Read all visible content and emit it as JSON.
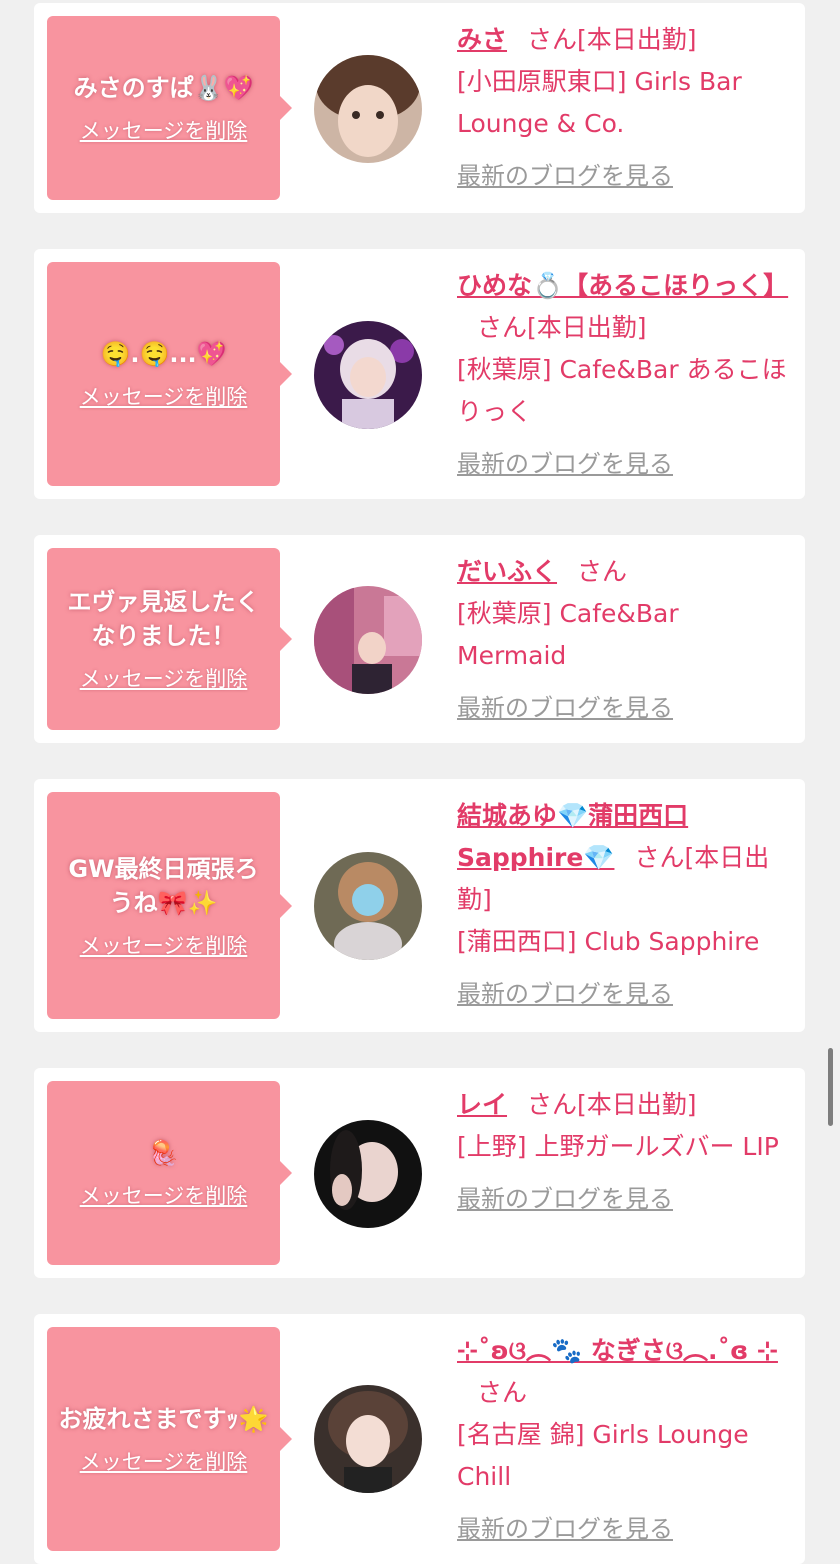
{
  "colors": {
    "accent": "#e23b68",
    "bubble": "#f8949f",
    "card": "#ffffff",
    "background": "#f0f0f0",
    "blog_link": "#9a9a9a"
  },
  "entries": [
    {
      "message": "みさのすぱ🐰💖",
      "delete_label": "メッセージを削除",
      "name": "みさ",
      "honorific": "さん",
      "status": "[本日出勤]",
      "shop": "[小田原駅東口] Girls Bar Lounge & Co.",
      "blog_link": "最新のブログを見る",
      "avatar_icon": "avatar-photo"
    },
    {
      "message": "🤤.🤤...💖",
      "delete_label": "メッセージを削除",
      "name": "ひめな💍【あるこほりっく】",
      "honorific": "さん",
      "status": "[本日出勤]",
      "shop": "[秋葉原] Cafe&Bar あるこほりっく",
      "blog_link": "最新のブログを見る",
      "avatar_icon": "avatar-photo"
    },
    {
      "message": "エヴァ見返したくなりました！",
      "delete_label": "メッセージを削除",
      "name": "だいふく",
      "honorific": "さん",
      "status": "",
      "shop": "[秋葉原] Cafe&Bar Mermaid",
      "blog_link": "最新のブログを見る",
      "avatar_icon": "avatar-photo"
    },
    {
      "message": "GW最終日頑張ろうね🎀✨",
      "delete_label": "メッセージを削除",
      "name": "結城あゆ💎蒲田西口Sapphire💎",
      "honorific": "さん",
      "status": "[本日出勤]",
      "shop": "[蒲田西口] Club Sapphire",
      "blog_link": "最新のブログを見る",
      "avatar_icon": "avatar-photo"
    },
    {
      "message": "🪼",
      "delete_label": "メッセージを削除",
      "name": "レイ",
      "honorific": "さん",
      "status": "[本日出勤]",
      "shop": "[上野] 上野ガールズバー LIP",
      "blog_link": "最新のブログを見る",
      "avatar_icon": "avatar-photo"
    },
    {
      "message": "お疲れさまですｯ🌟",
      "delete_label": "メッセージを削除",
      "name": "⊹˚ʚ︎ଓ︵🐾 なぎさଓ︵.˚ɞ︎ ⊹",
      "honorific": "さん",
      "status": "",
      "shop": "[名古屋 錦] Girls Lounge Chill",
      "blog_link": "最新のブログを見る",
      "avatar_icon": "avatar-photo"
    }
  ]
}
